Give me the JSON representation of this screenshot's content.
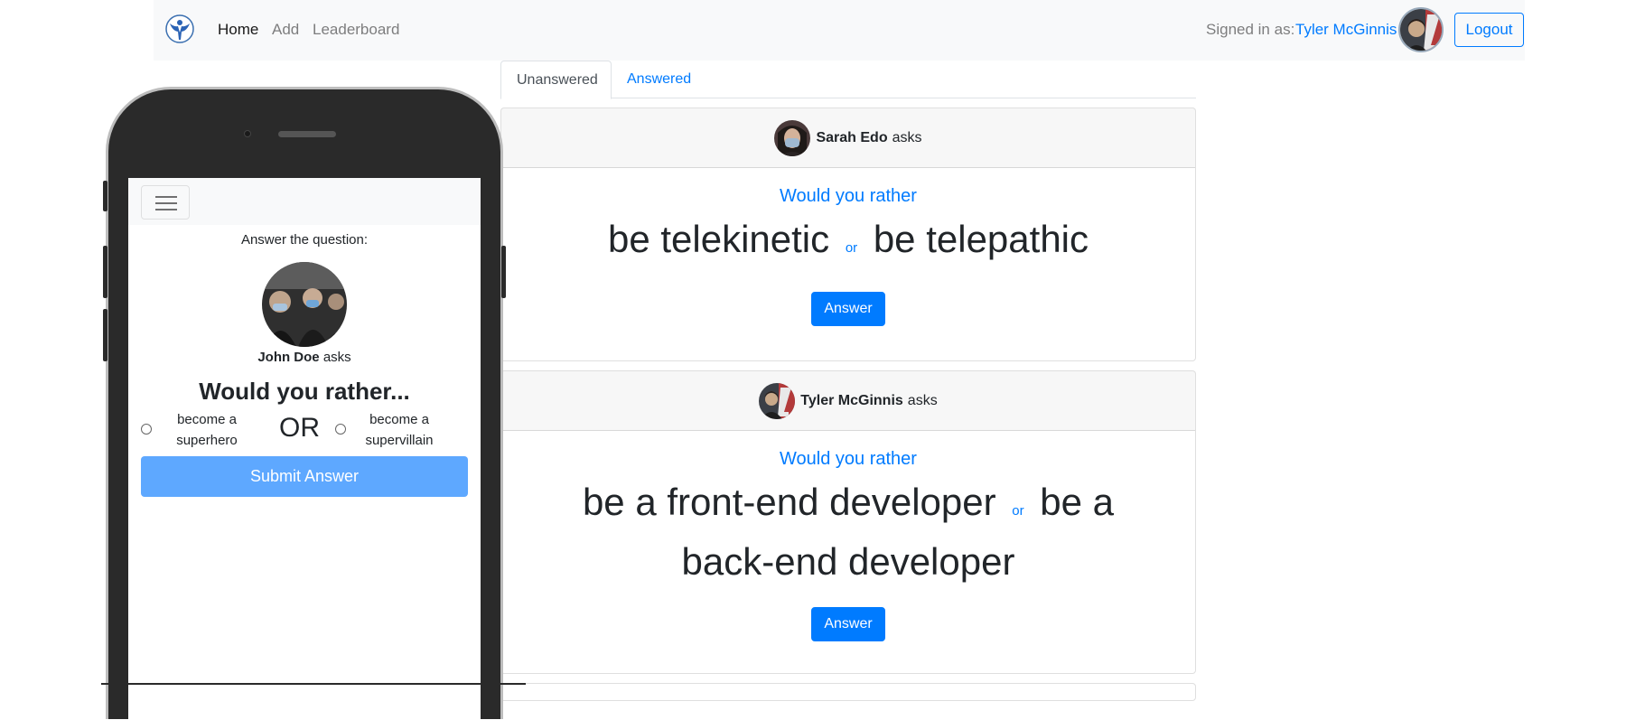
{
  "navbar": {
    "links": [
      "Home",
      "Add",
      "Leaderboard"
    ],
    "signed_in_label": "Signed in as:",
    "user_name": "Tyler McGinnis",
    "logout_label": "Logout"
  },
  "tabs": [
    "Unanswered",
    "Answered"
  ],
  "questions": [
    {
      "asker": "Sarah Edo",
      "asks": "asks",
      "prompt": "Would you rather",
      "option_one": "be telekinetic",
      "or": "or",
      "option_two": "be telepathic",
      "button": "Answer"
    },
    {
      "asker": "Tyler McGinnis",
      "asks": "asks",
      "prompt": "Would you rather",
      "option_one": "be a front-end developer",
      "or": "or",
      "option_two": "be a back-end developer",
      "button": "Answer"
    }
  ],
  "mobile": {
    "title": "Answer the question:",
    "asker": "John Doe",
    "asks": "asks",
    "heading": "Would you rather...",
    "option_one": "become a superhero",
    "or": "OR",
    "option_two": "become a supervillain",
    "submit": "Submit Answer"
  },
  "colors": {
    "primary": "#007bff",
    "navbar_bg": "#f8f9fa",
    "submit_disabled": "#5ea8ff",
    "phone_body": "#2a2a2a"
  },
  "icons": [
    "app-logo-icon",
    "hamburger-menu-icon"
  ]
}
